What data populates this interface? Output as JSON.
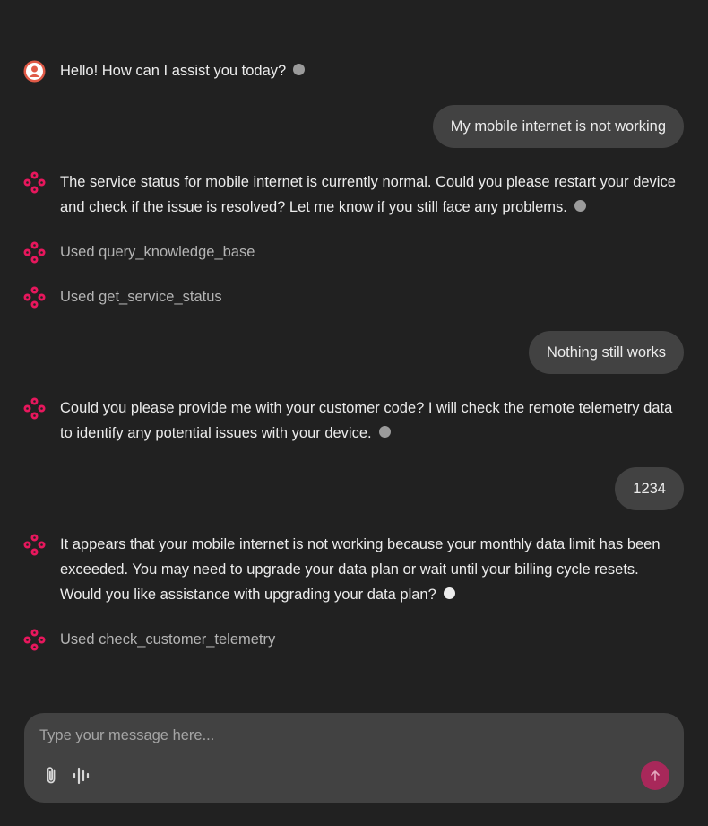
{
  "conversation": {
    "greeting": "Hello! How can I assist you today?",
    "user_1": "My mobile internet is not working",
    "assistant_1": "The service status for mobile internet is currently normal. Could you please restart your device and check if the issue is resolved? Let me know if you still face any problems.",
    "tool_1": "Used query_knowledge_base",
    "tool_2": "Used get_service_status",
    "user_2": "Nothing still works",
    "assistant_2": "Could you please provide me with your customer code? I will check the remote telemetry data to identify any potential issues with your device.",
    "user_3": "1234",
    "assistant_3": "It appears that your mobile internet is not working because your monthly data limit has been exceeded. You may need to upgrade your data plan or wait until your billing cycle resets. Would you like assistance with upgrading your data plan?",
    "tool_3": "Used check_customer_telemetry"
  },
  "composer": {
    "placeholder": "Type your message here...",
    "value": ""
  },
  "icons": {
    "user_avatar": "person-icon",
    "assistant_avatar": "diamond-dots-logo",
    "attach": "paperclip-icon",
    "voice": "audio-waveform-icon",
    "send": "arrow-up-icon"
  },
  "colors": {
    "background": "#212121",
    "bubble": "#424242",
    "accent": "#e8175d",
    "send_button": "#a8285a"
  }
}
